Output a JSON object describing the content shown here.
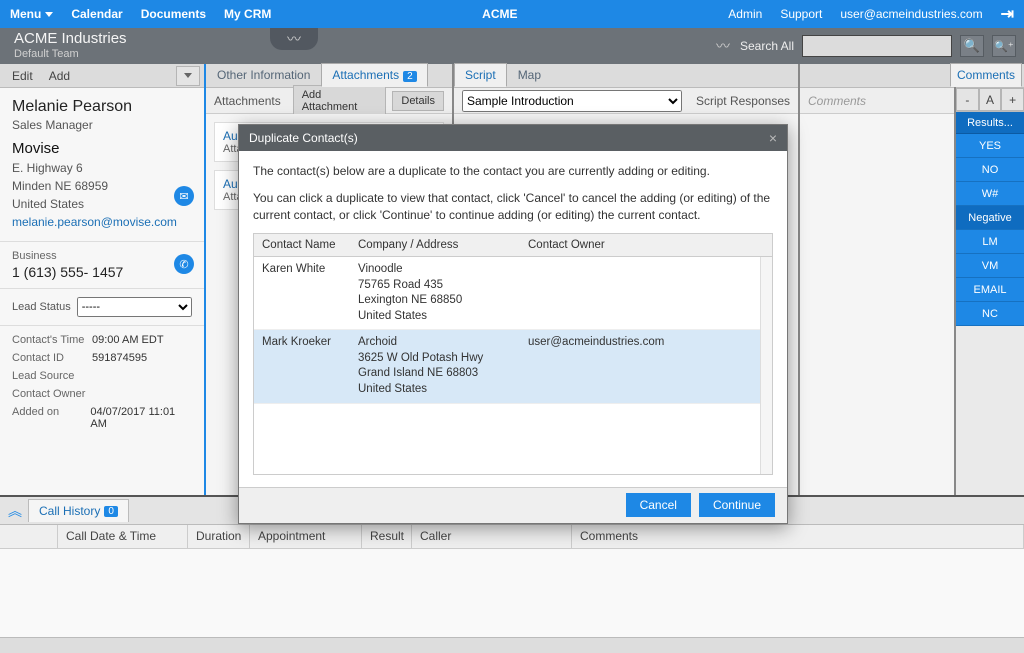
{
  "topbar": {
    "menu": "Menu",
    "calendar": "Calendar",
    "documents": "Documents",
    "mycrm": "My CRM",
    "center": "ACME",
    "admin": "Admin",
    "support": "Support",
    "user": "user@acmeindustries.com"
  },
  "subbar": {
    "company": "ACME Industries",
    "team": "Default Team",
    "search_label": "Search All",
    "search_value": ""
  },
  "contact": {
    "edit": "Edit",
    "add": "Add",
    "name": "Melanie  Pearson",
    "title": "Sales Manager",
    "company": "Movise",
    "addr1": "E. Highway 6",
    "addr2": "Minden   NE  68959",
    "country": "United States",
    "email": "melanie.pearson@movise.com",
    "phone_label": "Business",
    "phone": "1 (613) 555- 1457",
    "lead_label": "Lead Status",
    "lead_value": "-----",
    "meta": {
      "time_k": "Contact's Time",
      "time_v": "09:00 AM EDT",
      "id_k": "Contact ID",
      "id_v": "591874595",
      "src_k": "Lead Source",
      "src_v": "",
      "owner_k": "Contact Owner",
      "owner_v": "",
      "added_k": "Added on",
      "added_v": "04/07/2017 11:01 AM"
    }
  },
  "mid": {
    "tabA1": "Other Information",
    "tabA2": "Attachments",
    "tabA2_badge": "2",
    "attach_title": "Attachments",
    "btn_add_attachment": "Add Attachment",
    "btn_details": "Details",
    "att_audio_prefix": "Aud",
    "att_sub": "Atta",
    "tabB1": "Script",
    "tabB2": "Map",
    "script_select": "Sample Introduction",
    "script_resp": "Script Responses",
    "comments_tab": "Comments",
    "comments_placeholder": "Comments",
    "chip_minus": "-",
    "chip_a": "A",
    "chip_plus": "+",
    "results": "Results...",
    "buttons": [
      "YES",
      "NO",
      "W#",
      "Negative",
      "LM",
      "VM",
      "EMAIL",
      "NC"
    ]
  },
  "callhist": {
    "tab": "Call History",
    "badge": "0",
    "cols": {
      "spacer": "",
      "date": "Call Date & Time",
      "duration": "Duration",
      "appt": "Appointment",
      "result": "Result",
      "caller": "Caller",
      "comments": "Comments"
    }
  },
  "modal": {
    "title": "Duplicate Contact(s)",
    "p1": "The contact(s) below are a duplicate to the contact you are currently adding or editing.",
    "p2": "You can click a duplicate to view that contact, click 'Cancel' to cancel the adding (or editing) of the current contact, or click 'Continue' to continue adding (or editing) the current contact.",
    "h_name": "Contact Name",
    "h_addr": "Company / Address",
    "h_owner": "Contact Owner",
    "rows": [
      {
        "name": "Karen White",
        "company": "Vinoodle",
        "addr1": "75765 Road 435",
        "addr2": "Lexington NE 68850",
        "country": "United States",
        "owner": ""
      },
      {
        "name": "Mark Kroeker",
        "company": "Archoid",
        "addr1": "3625 W Old Potash Hwy",
        "addr2": "Grand Island NE 68803",
        "country": "United States",
        "owner": "user@acmeindustries.com"
      }
    ],
    "cancel": "Cancel",
    "continue": "Continue"
  }
}
